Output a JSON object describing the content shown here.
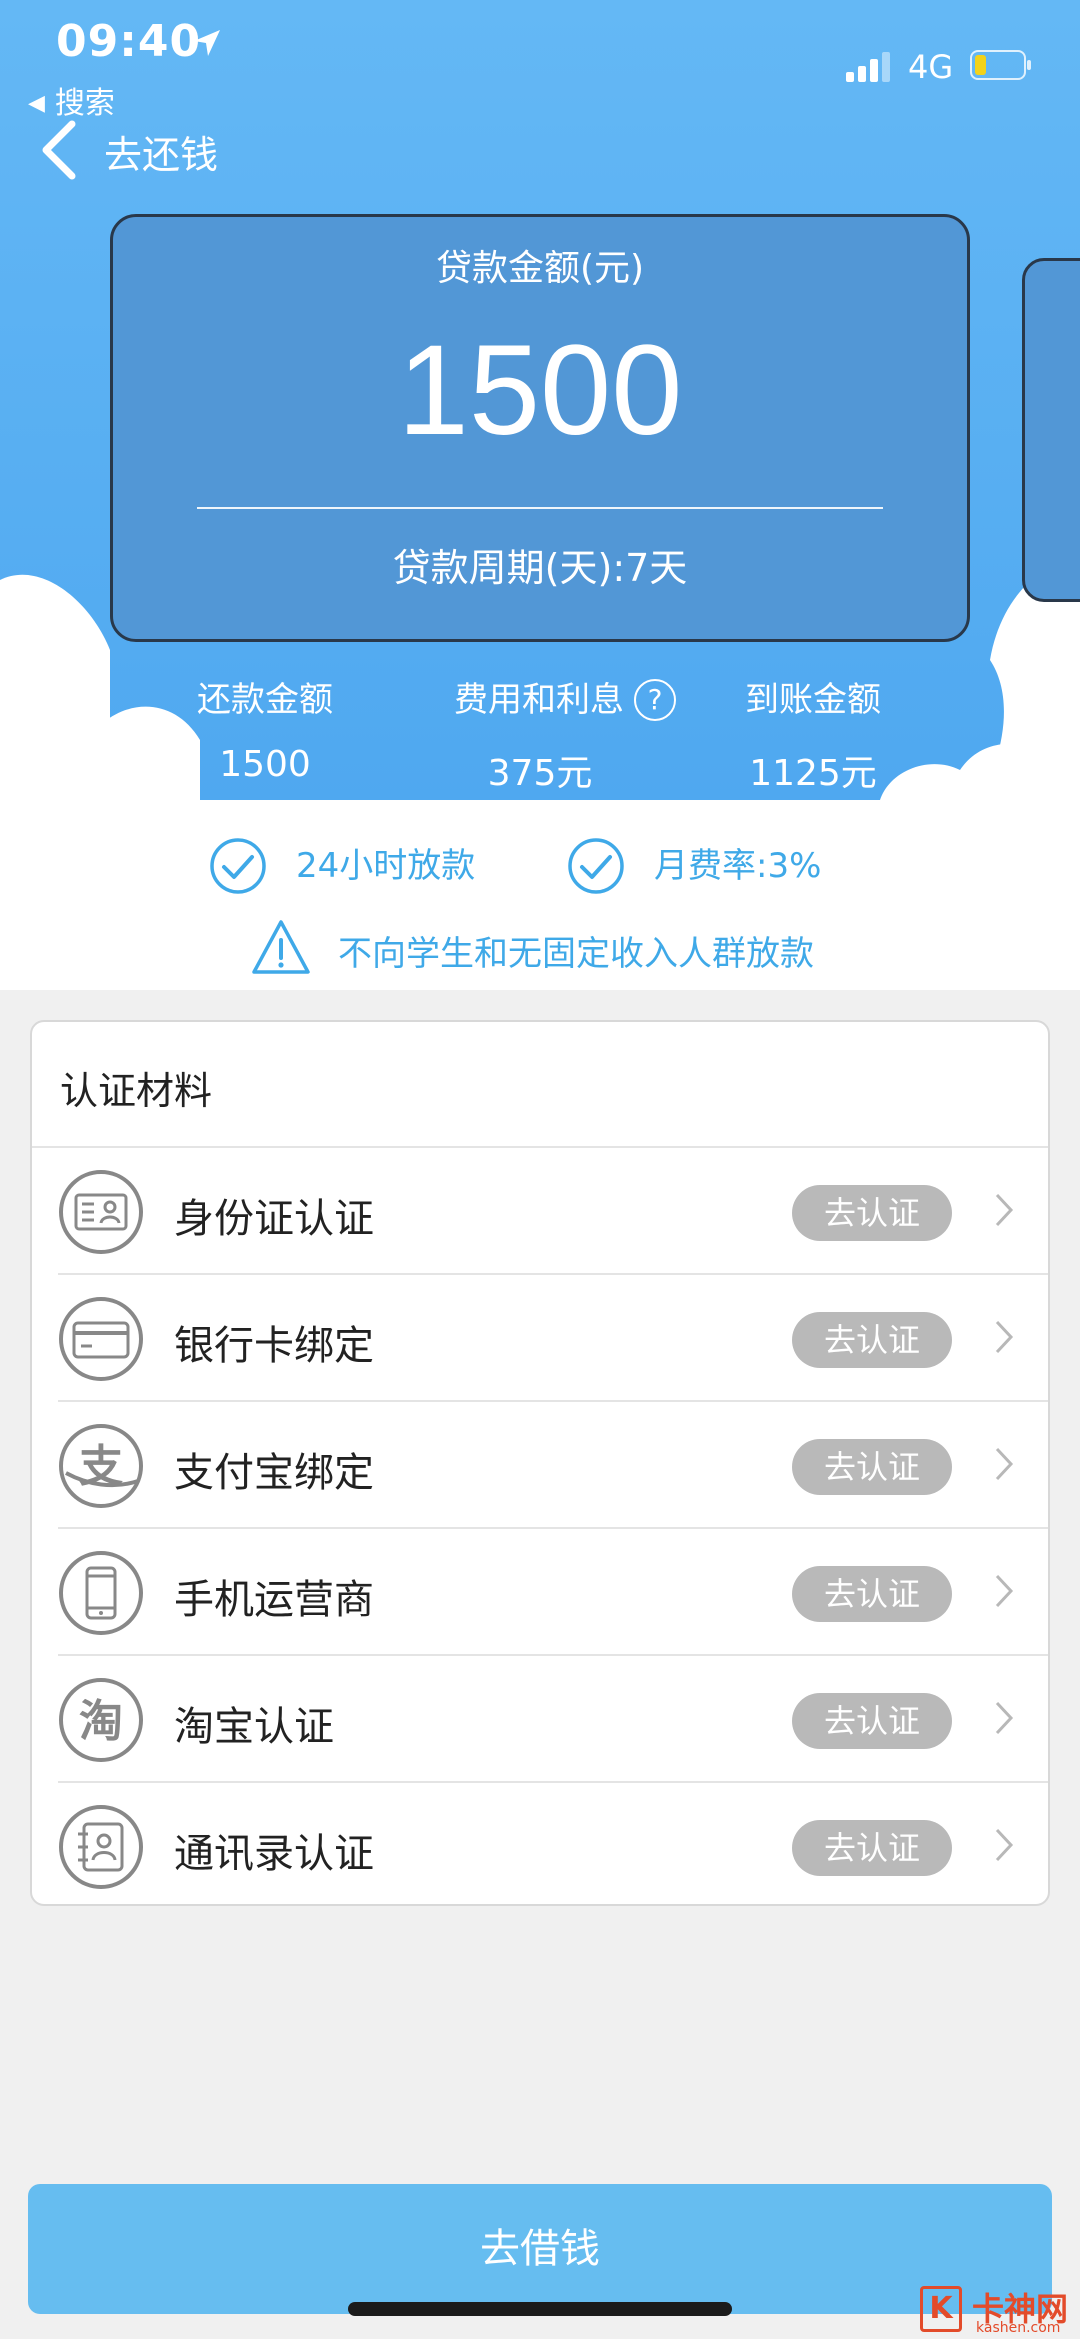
{
  "status_bar": {
    "time": "09:40",
    "network": "4G"
  },
  "back_app": {
    "label": "搜索"
  },
  "nav": {
    "title": "去还钱"
  },
  "loan": {
    "amount_label": "贷款金额(元)",
    "amount": "1500",
    "period_label": "贷款周期(天):7天"
  },
  "summary": {
    "repay_label": "还款金额",
    "repay_value": "1500",
    "fee_label": "费用和利息",
    "fee_value": "375元",
    "received_label": "到账金额",
    "received_value": "1125元"
  },
  "features": {
    "item1": "24小时放款",
    "item2": "月费率:3%",
    "notice": "不向学生和无固定收入人群放款"
  },
  "certification": {
    "title": "认证材料",
    "items": [
      {
        "label": "身份证认证",
        "action": "去认证",
        "icon": "id-card-icon"
      },
      {
        "label": "银行卡绑定",
        "action": "去认证",
        "icon": "bank-card-icon"
      },
      {
        "label": "支付宝绑定",
        "action": "去认证",
        "icon": "alipay-icon"
      },
      {
        "label": "手机运营商",
        "action": "去认证",
        "icon": "mobile-phone-icon"
      },
      {
        "label": "淘宝认证",
        "action": "去认证",
        "icon": "taobao-icon"
      },
      {
        "label": "通讯录认证",
        "action": "去认证",
        "icon": "contacts-icon"
      }
    ]
  },
  "actions": {
    "borrow": "去借钱"
  },
  "watermark": {
    "text": "卡神网",
    "url": "kashen.com",
    "logo_letter": "K"
  },
  "colors": {
    "hero_blue": "#5aaef2",
    "card_blue": "#5297d6",
    "accent_text": "#3fa9e8",
    "badge_gray": "#b9b9b9",
    "button_blue": "#66bdf0"
  }
}
